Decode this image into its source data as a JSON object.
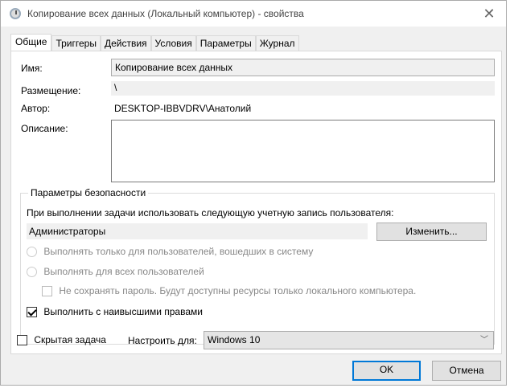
{
  "window": {
    "title": "Копирование всех данных (Локальный компьютер) - свойства",
    "close": "✕"
  },
  "tabs": [
    "Общие",
    "Триггеры",
    "Действия",
    "Условия",
    "Параметры",
    "Журнал"
  ],
  "general": {
    "name_label": "Имя:",
    "name_value": "Копирование всех данных",
    "location_label": "Размещение:",
    "location_value": "\\",
    "author_label": "Автор:",
    "author_value": "DESKTOP-IBBVDRV\\Анатолий",
    "description_label": "Описание:",
    "description_value": ""
  },
  "security": {
    "title": "Параметры безопасности",
    "account_prompt": "При выполнении задачи использовать следующую учетную запись пользователя:",
    "account_value": "Администраторы",
    "change_button": "Изменить...",
    "radio_logged_on": "Выполнять только для пользователей, вошедших в систему",
    "radio_all_users": "Выполнять для всех пользователей",
    "no_store_password": "Не сохранять пароль. Будут доступны ресурсы только локального компьютера.",
    "highest_privileges": "Выполнить с наивысшими правами",
    "highest_privileges_checked": true
  },
  "hidden_label": "Скрытая задача",
  "hidden_checked": false,
  "configure_label": "Настроить для:",
  "configure_value": "Windows 10",
  "buttons": {
    "ok": "OK",
    "cancel": "Отмена"
  }
}
